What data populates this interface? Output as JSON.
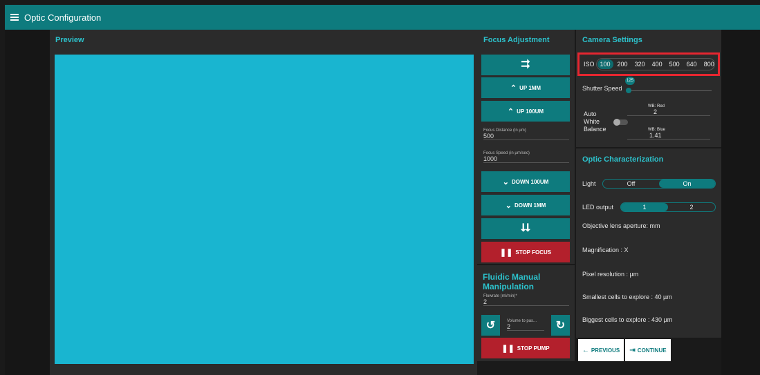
{
  "app": {
    "title": "Optic Configuration",
    "menu_icon": "hamburger-menu-icon"
  },
  "colors": {
    "accent": "#0e7b7e",
    "danger": "#b3202c",
    "preview": "#19b5d0",
    "highlight": "#e62630"
  },
  "preview": {
    "title": "Preview"
  },
  "focus": {
    "title": "Focus Adjustment",
    "up_big_icon": "double-chevron-up-icon",
    "up_1mm": "UP 1MM",
    "up_100um": "UP 100UM",
    "distance_label": "Focus Distance (in µm)",
    "distance_value": "500",
    "speed_label": "Focus Speed (in µm/sec)",
    "speed_value": "1000",
    "down_100um": "DOWN 100UM",
    "down_1mm": "DOWN 1MM",
    "down_big_icon": "double-chevron-down-icon",
    "stop": "STOP FOCUS"
  },
  "fluidic": {
    "title": "Fluidic Manual Manipulation",
    "flowrate_label": "Flowrate (ml/min)*",
    "flowrate_value": "2",
    "volume_label": "Volume to pas...",
    "volume_value": "2",
    "stop": "STOP PUMP"
  },
  "camera": {
    "title": "Camera Settings",
    "iso_label": "ISO",
    "iso_options": [
      "100",
      "200",
      "320",
      "400",
      "500",
      "640",
      "800"
    ],
    "iso_selected": "100",
    "shutter_label": "Shutter Speed",
    "shutter_value": "125",
    "awb_label": "Auto White Balance",
    "wb_red_label": "WB: Red",
    "wb_red_value": "2",
    "wb_blue_label": "WB: Blue",
    "wb_blue_value": "1.41"
  },
  "optic": {
    "title": "Optic Characterization",
    "light_label": "Light",
    "light_off": "Off",
    "light_on": "On",
    "led_label": "LED output",
    "led_1": "1",
    "led_2": "2",
    "aperture": "Objective lens aperture: mm",
    "magnification": "Magnification : X",
    "pixel_resolution": "Pixel resolution : µm",
    "smallest": "Smallest cells to explore : 40 µm",
    "biggest": "Biggest cells to explore : 430 µm"
  },
  "nav": {
    "previous": "PREVIOUS",
    "continue": "CONTINUE"
  }
}
